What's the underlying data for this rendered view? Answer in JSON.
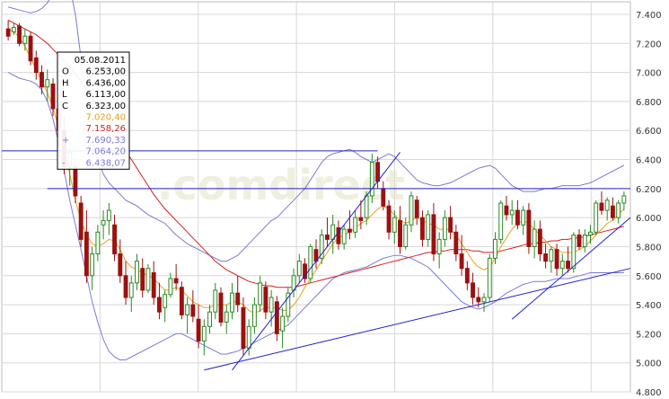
{
  "chart_data": {
    "type": "candlestick",
    "title": "",
    "xlabel": "",
    "ylabel": "",
    "ylim": [
      4.8,
      7.4
    ],
    "yticks": [
      "7.400",
      "7.200",
      "7.000",
      "6.800",
      "6.600",
      "6.400",
      "6.200",
      "6.000",
      "5.800",
      "5.600",
      "5.400",
      "5.200",
      "5.000",
      "4.800"
    ],
    "grid": true,
    "watermark": ".comdirect",
    "colors": {
      "up": "#2a8a22",
      "down": "#9c1010",
      "ma_short": "#e8a020",
      "ma_long": "#d42020",
      "bollinger": "#7a7ad8",
      "trendline": "#2020c8",
      "grid": "#d8d8d8"
    },
    "tooltip": {
      "date": "05.08.2011",
      "rows": [
        {
          "key": "O",
          "value": "6.253,00",
          "color": "#000000"
        },
        {
          "key": "H",
          "value": "6.436,00",
          "color": "#000000"
        },
        {
          "key": "L",
          "value": "6.113,00",
          "color": "#000000"
        },
        {
          "key": "C",
          "value": "6.323,00",
          "color": "#000000"
        },
        {
          "key": "",
          "value": "7.020,40",
          "color": "#e8a020"
        },
        {
          "key": "",
          "value": "7.158,26",
          "color": "#d42020"
        },
        {
          "key": "+",
          "value": "7.690,33",
          "color": "#7a7ad8"
        },
        {
          "key": "",
          "value": "7.064,20",
          "color": "#7a7ad8"
        },
        {
          "key": "-",
          "value": "6.438,07",
          "color": "#7a7ad8"
        }
      ]
    },
    "candles": [
      [
        7.3,
        7.36,
        7.22,
        7.25
      ],
      [
        7.28,
        7.34,
        7.26,
        7.31
      ],
      [
        7.32,
        7.34,
        7.18,
        7.2
      ],
      [
        7.2,
        7.3,
        7.15,
        7.25
      ],
      [
        7.25,
        7.28,
        7.05,
        7.08
      ],
      [
        7.1,
        7.15,
        6.95,
        7.0
      ],
      [
        7.0,
        7.05,
        6.85,
        6.9
      ],
      [
        6.9,
        7.02,
        6.8,
        6.95
      ],
      [
        6.92,
        6.96,
        6.7,
        6.75
      ],
      [
        6.75,
        6.8,
        6.55,
        6.6
      ],
      [
        6.6,
        6.7,
        6.3,
        6.35
      ],
      [
        6.36,
        6.52,
        6.22,
        6.45
      ],
      [
        6.35,
        6.4,
        6.1,
        6.15
      ],
      [
        6.1,
        6.15,
        5.8,
        5.85
      ],
      [
        5.9,
        6.05,
        5.55,
        5.6
      ],
      [
        5.6,
        5.8,
        5.5,
        5.75
      ],
      [
        5.75,
        5.95,
        5.7,
        5.9
      ],
      [
        5.95,
        6.05,
        5.85,
        5.98
      ],
      [
        5.98,
        6.1,
        5.88,
        6.05
      ],
      [
        5.95,
        6.02,
        5.7,
        5.75
      ],
      [
        5.75,
        5.85,
        5.55,
        5.6
      ],
      [
        5.6,
        5.7,
        5.4,
        5.45
      ],
      [
        5.45,
        5.6,
        5.35,
        5.55
      ],
      [
        5.55,
        5.75,
        5.5,
        5.7
      ],
      [
        5.65,
        5.72,
        5.45,
        5.5
      ],
      [
        5.5,
        5.68,
        5.48,
        5.65
      ],
      [
        5.62,
        5.7,
        5.4,
        5.45
      ],
      [
        5.45,
        5.55,
        5.3,
        5.35
      ],
      [
        5.38,
        5.5,
        5.28,
        5.47
      ],
      [
        5.47,
        5.62,
        5.45,
        5.58
      ],
      [
        5.58,
        5.68,
        5.5,
        5.55
      ],
      [
        5.52,
        5.56,
        5.3,
        5.33
      ],
      [
        5.33,
        5.45,
        5.2,
        5.4
      ],
      [
        5.4,
        5.5,
        5.28,
        5.32
      ],
      [
        5.3,
        5.4,
        5.1,
        5.15
      ],
      [
        5.15,
        5.3,
        5.05,
        5.25
      ],
      [
        5.25,
        5.4,
        5.2,
        5.35
      ],
      [
        5.35,
        5.55,
        5.3,
        5.5
      ],
      [
        5.48,
        5.52,
        5.25,
        5.28
      ],
      [
        5.28,
        5.4,
        5.2,
        5.35
      ],
      [
        5.35,
        5.55,
        5.3,
        5.48
      ],
      [
        5.48,
        5.6,
        5.35,
        5.4
      ],
      [
        5.38,
        5.45,
        5.05,
        5.1
      ],
      [
        5.1,
        5.3,
        5.05,
        5.25
      ],
      [
        5.25,
        5.45,
        5.2,
        5.4
      ],
      [
        5.4,
        5.6,
        5.35,
        5.55
      ],
      [
        5.52,
        5.56,
        5.3,
        5.35
      ],
      [
        5.35,
        5.5,
        5.25,
        5.45
      ],
      [
        5.42,
        5.46,
        5.15,
        5.2
      ],
      [
        5.22,
        5.38,
        5.1,
        5.32
      ],
      [
        5.32,
        5.52,
        5.28,
        5.48
      ],
      [
        5.5,
        5.65,
        5.45,
        5.6
      ],
      [
        5.6,
        5.75,
        5.55,
        5.7
      ],
      [
        5.68,
        5.72,
        5.55,
        5.58
      ],
      [
        5.58,
        5.82,
        5.55,
        5.8
      ],
      [
        5.78,
        5.85,
        5.65,
        5.7
      ],
      [
        5.72,
        5.92,
        5.68,
        5.88
      ],
      [
        5.88,
        6.0,
        5.8,
        5.85
      ],
      [
        5.85,
        6.02,
        5.75,
        5.95
      ],
      [
        5.93,
        5.98,
        5.78,
        5.82
      ],
      [
        5.82,
        5.95,
        5.78,
        5.92
      ],
      [
        5.92,
        6.05,
        5.85,
        5.9
      ],
      [
        5.9,
        6.05,
        5.86,
        6.0
      ],
      [
        6.0,
        6.12,
        5.92,
        5.98
      ],
      [
        6.0,
        6.18,
        5.95,
        6.15
      ],
      [
        6.15,
        6.44,
        6.1,
        6.38
      ],
      [
        6.38,
        6.42,
        6.2,
        6.25
      ],
      [
        6.2,
        6.25,
        6.05,
        6.08
      ],
      [
        6.08,
        6.12,
        5.85,
        5.9
      ],
      [
        5.9,
        6.05,
        5.82,
        6.0
      ],
      [
        5.98,
        6.08,
        5.75,
        5.8
      ],
      [
        5.8,
        6.0,
        5.78,
        5.95
      ],
      [
        5.95,
        6.18,
        5.9,
        6.15
      ],
      [
        6.12,
        6.15,
        5.95,
        6.0
      ],
      [
        6.0,
        6.05,
        5.8,
        5.85
      ],
      [
        5.85,
        6.05,
        5.8,
        6.02
      ],
      [
        6.02,
        6.1,
        5.7,
        5.75
      ],
      [
        5.75,
        5.9,
        5.65,
        5.85
      ],
      [
        5.85,
        6.05,
        5.8,
        6.0
      ],
      [
        6.0,
        6.08,
        5.85,
        5.9
      ],
      [
        5.9,
        5.95,
        5.7,
        5.75
      ],
      [
        5.75,
        5.88,
        5.6,
        5.65
      ],
      [
        5.65,
        5.7,
        5.5,
        5.55
      ],
      [
        5.55,
        5.62,
        5.4,
        5.45
      ],
      [
        5.45,
        5.52,
        5.38,
        5.42
      ],
      [
        5.42,
        5.48,
        5.35,
        5.45
      ],
      [
        5.45,
        5.75,
        5.42,
        5.72
      ],
      [
        5.72,
        5.9,
        5.68,
        5.85
      ],
      [
        5.85,
        6.12,
        5.82,
        6.1
      ],
      [
        6.08,
        6.15,
        5.98,
        6.02
      ],
      [
        6.02,
        6.12,
        5.95,
        6.05
      ],
      [
        6.05,
        6.12,
        5.92,
        5.95
      ],
      [
        5.95,
        6.08,
        5.88,
        6.05
      ],
      [
        6.05,
        6.1,
        5.75,
        5.8
      ],
      [
        5.8,
        5.98,
        5.72,
        5.92
      ],
      [
        5.92,
        5.98,
        5.7,
        5.75
      ],
      [
        5.75,
        5.82,
        5.65,
        5.7
      ],
      [
        5.7,
        5.8,
        5.62,
        5.78
      ],
      [
        5.78,
        5.82,
        5.6,
        5.65
      ],
      [
        5.65,
        5.75,
        5.6,
        5.7
      ],
      [
        5.7,
        5.8,
        5.62,
        5.65
      ],
      [
        5.65,
        5.9,
        5.62,
        5.88
      ],
      [
        5.88,
        5.92,
        5.78,
        5.8
      ],
      [
        5.8,
        5.92,
        5.76,
        5.88
      ],
      [
        5.88,
        5.95,
        5.82,
        5.9
      ],
      [
        5.9,
        6.12,
        5.88,
        6.1
      ],
      [
        6.1,
        6.18,
        6.02,
        6.05
      ],
      [
        6.05,
        6.14,
        5.98,
        6.12
      ],
      [
        6.08,
        6.14,
        5.98,
        6.0
      ],
      [
        6.0,
        6.12,
        5.96,
        6.1
      ],
      [
        6.1,
        6.18,
        6.05,
        6.15
      ]
    ],
    "ma_short": [
      7.3,
      7.28,
      7.24,
      7.18,
      7.1,
      7.02,
      6.94,
      6.86,
      6.76,
      6.62,
      6.46,
      6.3,
      6.12,
      5.98,
      5.88,
      5.82,
      5.8,
      5.82,
      5.85,
      5.84,
      5.78,
      5.7,
      5.66,
      5.64,
      5.62,
      5.6,
      5.58,
      5.54,
      5.5,
      5.5,
      5.52,
      5.5,
      5.46,
      5.42,
      5.4,
      5.38,
      5.38,
      5.4,
      5.4,
      5.4,
      5.42,
      5.42,
      5.4,
      5.36,
      5.34,
      5.36,
      5.38,
      5.38,
      5.38,
      5.36,
      5.36,
      5.4,
      5.45,
      5.52,
      5.58,
      5.64,
      5.7,
      5.76,
      5.82,
      5.86,
      5.88,
      5.9,
      5.93,
      5.96,
      5.98,
      6.02,
      6.06,
      6.08,
      6.06,
      6.02,
      5.98,
      5.96,
      5.98,
      6.0,
      5.98,
      5.96,
      5.95,
      5.92,
      5.92,
      5.92,
      5.88,
      5.82,
      5.76,
      5.7,
      5.66,
      5.64,
      5.66,
      5.72,
      5.8,
      5.86,
      5.92,
      5.96,
      5.98,
      5.96,
      5.92,
      5.88,
      5.84,
      5.8,
      5.78,
      5.76,
      5.76,
      5.76,
      5.78,
      5.8,
      5.84,
      5.88,
      5.92,
      5.96,
      5.98,
      6.02,
      6.06
    ],
    "ma_long": [
      7.36,
      7.34,
      7.32,
      7.3,
      7.28,
      7.26,
      7.23,
      7.2,
      7.16,
      7.12,
      7.08,
      7.04,
      6.99,
      6.94,
      6.88,
      6.82,
      6.76,
      6.7,
      6.64,
      6.58,
      6.52,
      6.46,
      6.4,
      6.34,
      6.28,
      6.22,
      6.16,
      6.11,
      6.06,
      6.02,
      5.98,
      5.94,
      5.9,
      5.86,
      5.82,
      5.78,
      5.74,
      5.7,
      5.67,
      5.64,
      5.62,
      5.6,
      5.58,
      5.56,
      5.55,
      5.54,
      5.53,
      5.53,
      5.52,
      5.52,
      5.52,
      5.52,
      5.53,
      5.54,
      5.55,
      5.56,
      5.57,
      5.58,
      5.59,
      5.6,
      5.61,
      5.62,
      5.63,
      5.64,
      5.65,
      5.66,
      5.67,
      5.68,
      5.69,
      5.7,
      5.71,
      5.72,
      5.73,
      5.74,
      5.75,
      5.76,
      5.76,
      5.77,
      5.77,
      5.78,
      5.78,
      5.78,
      5.78,
      5.77,
      5.77,
      5.76,
      5.76,
      5.76,
      5.77,
      5.78,
      5.79,
      5.8,
      5.81,
      5.82,
      5.82,
      5.83,
      5.83,
      5.84,
      5.84,
      5.85,
      5.85,
      5.86,
      5.86,
      5.87,
      5.88,
      5.89,
      5.9,
      5.91,
      5.92,
      5.93,
      5.94
    ],
    "boll_upper": [
      7.45,
      7.44,
      7.43,
      7.42,
      7.41,
      7.42,
      7.44,
      7.48,
      7.55,
      7.62,
      7.66,
      7.6,
      7.4,
      7.1,
      6.8,
      6.55,
      6.4,
      6.3,
      6.24,
      6.2,
      6.16,
      6.12,
      6.1,
      6.08,
      6.05,
      6.02,
      6.0,
      5.98,
      5.96,
      5.92,
      5.88,
      5.85,
      5.82,
      5.8,
      5.78,
      5.76,
      5.74,
      5.72,
      5.7,
      5.7,
      5.72,
      5.74,
      5.78,
      5.82,
      5.86,
      5.9,
      5.94,
      5.98,
      6.0,
      6.04,
      6.08,
      6.12,
      6.16,
      6.2,
      6.26,
      6.32,
      6.38,
      6.42,
      6.44,
      6.45,
      6.46,
      6.47,
      6.45,
      6.42,
      6.4,
      6.38,
      6.4,
      6.42,
      6.44,
      6.42,
      6.38,
      6.34,
      6.3,
      6.26,
      6.24,
      6.23,
      6.22,
      6.22,
      6.23,
      6.24,
      6.26,
      6.28,
      6.3,
      6.32,
      6.34,
      6.35,
      6.36,
      6.34,
      6.3,
      6.26,
      6.22,
      6.2,
      6.18,
      6.18,
      6.18,
      6.19,
      6.2,
      6.2,
      6.21,
      6.22,
      6.22,
      6.22,
      6.22,
      6.23,
      6.24,
      6.26,
      6.28,
      6.3,
      6.32,
      6.34,
      6.36
    ],
    "boll_lower": [
      7.0,
      6.98,
      6.96,
      6.95,
      6.94,
      6.92,
      6.88,
      6.8,
      6.68,
      6.52,
      6.32,
      6.12,
      5.95,
      5.78,
      5.6,
      5.42,
      5.28,
      5.16,
      5.08,
      5.04,
      5.02,
      5.02,
      5.04,
      5.06,
      5.08,
      5.1,
      5.12,
      5.14,
      5.16,
      5.18,
      5.2,
      5.2,
      5.18,
      5.16,
      5.14,
      5.12,
      5.1,
      5.08,
      5.06,
      5.06,
      5.07,
      5.08,
      5.1,
      5.12,
      5.14,
      5.16,
      5.18,
      5.2,
      5.22,
      5.24,
      5.26,
      5.3,
      5.34,
      5.38,
      5.42,
      5.46,
      5.5,
      5.54,
      5.58,
      5.6,
      5.62,
      5.63,
      5.64,
      5.65,
      5.66,
      5.68,
      5.7,
      5.72,
      5.73,
      5.74,
      5.74,
      5.73,
      5.72,
      5.7,
      5.68,
      5.66,
      5.62,
      5.58,
      5.54,
      5.5,
      5.46,
      5.42,
      5.4,
      5.38,
      5.37,
      5.38,
      5.4,
      5.42,
      5.45,
      5.48,
      5.5,
      5.52,
      5.54,
      5.55,
      5.56,
      5.56,
      5.56,
      5.57,
      5.58,
      5.58,
      5.58,
      5.59,
      5.6,
      5.61,
      5.62,
      5.62,
      5.62,
      5.62,
      5.62,
      5.62,
      5.62
    ],
    "trendlines": [
      {
        "x0": 0,
        "y0": 6.46,
        "x1": 66,
        "y1": 6.46
      },
      {
        "x0": 7,
        "y0": 6.2,
        "x1": 112,
        "y1": 6.2
      },
      {
        "x0": 35,
        "y0": 4.95,
        "x1": 112,
        "y1": 5.65
      },
      {
        "x0": 40,
        "y0": 4.95,
        "x1": 70,
        "y1": 6.45
      },
      {
        "x0": 90,
        "y0": 5.3,
        "x1": 112,
        "y1": 6.0
      }
    ]
  }
}
